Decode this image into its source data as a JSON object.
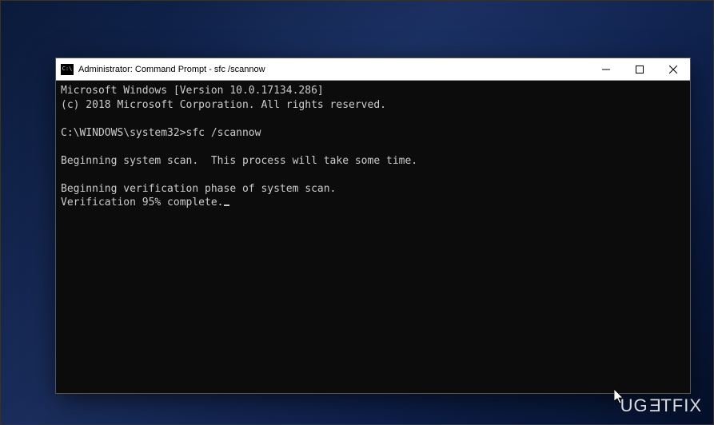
{
  "window": {
    "title": "Administrator: Command Prompt - sfc  /scannow"
  },
  "console": {
    "line1": "Microsoft Windows [Version 10.0.17134.286]",
    "line2": "(c) 2018 Microsoft Corporation. All rights reserved.",
    "blank1": "",
    "prompt_line": "C:\\WINDOWS\\system32>sfc /scannow",
    "blank2": "",
    "line3": "Beginning system scan.  This process will take some time.",
    "blank3": "",
    "line4": "Beginning verification phase of system scan.",
    "line5": "Verification 95% complete."
  },
  "watermark": {
    "text_part1": "UG",
    "text_part2": "E",
    "text_part3": "TFIX"
  }
}
